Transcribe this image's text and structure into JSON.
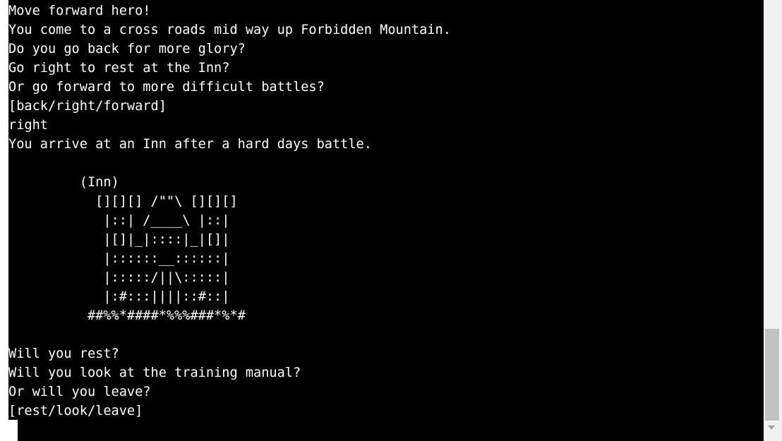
{
  "terminal": {
    "lines": [
      "Move forward hero!",
      "You come to a cross roads mid way up Forbidden Mountain.",
      "Do you go back for more glory?",
      "Go right to rest at the Inn?",
      "Or go forward to more difficult battles?",
      "[back/right/forward]",
      "right",
      "You arrive at an Inn after a hard days battle.",
      "",
      "         (Inn)",
      "           [][][] /\"\"\\ [][][]",
      "            |::| /____\\ |::|",
      "            |[]|_|::::|_|[]|",
      "            |::::::__::::::|",
      "            |:::::/||\\:::::|",
      "            |:#:::||||::#::|",
      "          ##%%*####*%%%###*%*#",
      "",
      "Will you rest?",
      "Will you look at the training manual?",
      "Or will you leave?",
      "[rest/look/leave]"
    ]
  },
  "scrollbar": {
    "position_fraction": 0.78
  }
}
